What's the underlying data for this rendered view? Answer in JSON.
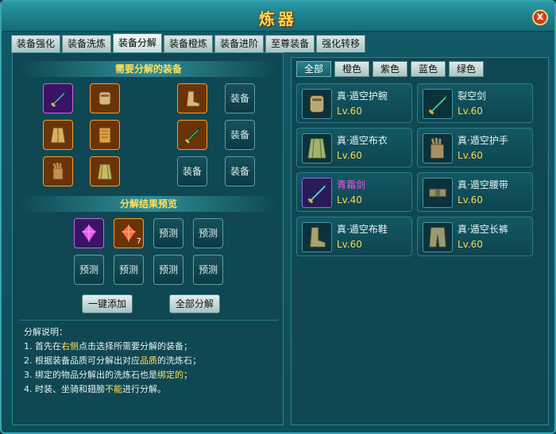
{
  "window": {
    "title": "炼器",
    "close_label": "X"
  },
  "tabs": [
    "装备强化",
    "装备洗炼",
    "装备分解",
    "装备橙炼",
    "装备进阶",
    "至尊装备",
    "强化转移"
  ],
  "left": {
    "need_title": "需要分解的装备",
    "result_title": "分解结果预览",
    "empty_equip": "装备",
    "predict": "预测",
    "gem_count": "7",
    "btn_add_all": "一键添加",
    "btn_decompose_all": "全部分解",
    "desc": {
      "head": "分解说明：",
      "l1_a": "1. 首先在",
      "l1_b": "右侧",
      "l1_c": "点击选择所需要分解的装备；",
      "l2_a": "2. 根据装备品质可分解出对应",
      "l2_b": "品质",
      "l2_c": "的洗炼石；",
      "l3_a": "3. 绑定的物品分解出的洗炼石也是",
      "l3_b": "绑定的",
      "l3_c": "；",
      "l4_a": "4. 时装、坐骑和翅膀",
      "l4_b": "不能",
      "l4_c": "进行分解。"
    }
  },
  "filters": [
    "全部",
    "橙色",
    "紫色",
    "蓝色",
    "绿色"
  ],
  "items": [
    {
      "name": "真·遁空护腕",
      "level": "Lv.60",
      "color": "#ffd44a",
      "icon": "bracer-icon"
    },
    {
      "name": "裂空剑",
      "level": "Lv.60",
      "color": "#ffd44a",
      "icon": "sword-icon"
    },
    {
      "name": "真·遁空布衣",
      "level": "Lv.60",
      "color": "#ffd44a",
      "icon": "robe-icon"
    },
    {
      "name": "真·遁空护手",
      "level": "Lv.60",
      "color": "#ffd44a",
      "icon": "glove-icon"
    },
    {
      "name": "青霜剑",
      "level": "Lv.40",
      "color": "#ee55ee",
      "icon": "sword-icon"
    },
    {
      "name": "真·遁空腰带",
      "level": "Lv.60",
      "color": "#ffd44a",
      "icon": "belt-icon"
    },
    {
      "name": "真·遁空布鞋",
      "level": "Lv.60",
      "color": "#ffd44a",
      "icon": "boots-icon"
    },
    {
      "name": "真·遁空长裤",
      "level": "Lv.60",
      "color": "#ffd44a",
      "icon": "pants-icon"
    }
  ],
  "colors": {
    "accent": "#ffe15a",
    "purple_quality": "#ee55ee",
    "orange_quality": "#ffd44a"
  }
}
